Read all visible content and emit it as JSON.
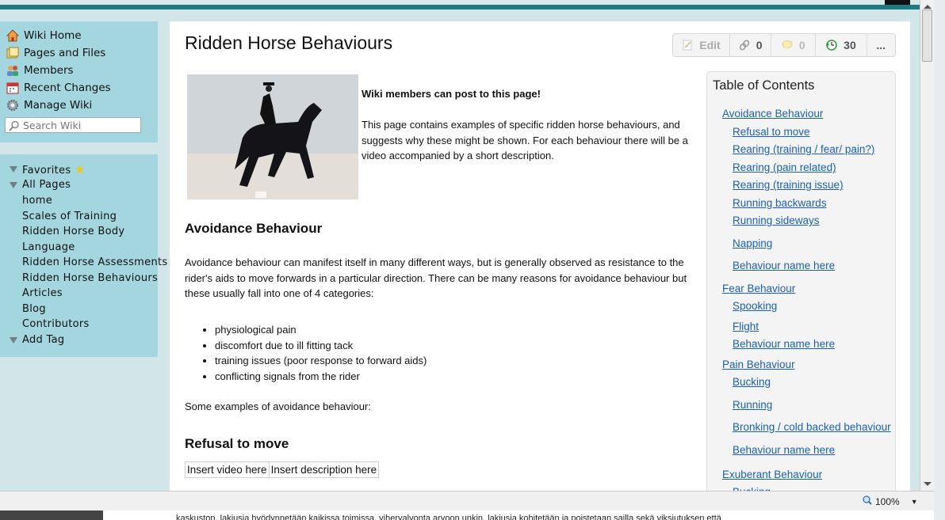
{
  "sidebar": {
    "top_items": [
      {
        "label": "Wiki Home",
        "icon": "house-icon"
      },
      {
        "label": "Pages and Files",
        "icon": "folder-icon"
      },
      {
        "label": "Members",
        "icon": "members-icon"
      },
      {
        "label": "Recent Changes",
        "icon": "calendar-icon"
      },
      {
        "label": "Manage Wiki",
        "icon": "gear-icon"
      }
    ],
    "search_placeholder": "Search Wiki",
    "favorites_label": "Favorites",
    "all_pages_label": "All Pages",
    "pages": [
      "home",
      "Scales of Training",
      "Ridden Horse Body",
      "Language",
      "Ridden Horse Assessments",
      "Ridden Horse Behaviours",
      "Articles",
      "Blog",
      "Contributors"
    ],
    "add_tag_label": "Add Tag"
  },
  "page": {
    "title": "Ridden Horse Behaviours",
    "toolbar": {
      "edit_label": "Edit",
      "links_count": "0",
      "comments_count": "0",
      "revisions_count": "30",
      "more_label": "..."
    },
    "intro_bold": "Wiki members can post to this page!",
    "intro_text": "This page contains examples of specific ridden horse behaviours, and suggests why these might be shown. For each behaviour there will be a video accompanied by a short description.",
    "section1_heading": "Avoidance Behaviour",
    "section1_text": "Avoidance behaviour can manifest itself in many different ways, but is generally observed as resistance to the rider's aids to move forwards in a particular direction. There can be many reasons for avoidance behaviour but these usually fall into one of 4 categories:",
    "bullets": [
      "physiological pain",
      "discomfort due to ill fitting tack",
      "training issues (poor response to forward aids)",
      "conflicting signals from the rider"
    ],
    "examples_text": "Some examples of avoidance behaviour:",
    "subsection_heading": "Refusal to move",
    "table": {
      "video": "Insert video here",
      "description": "Insert description here"
    }
  },
  "toc": {
    "title": "Table of Contents",
    "items": [
      {
        "label": "Avoidance Behaviour",
        "level": 1
      },
      {
        "label": "Refusal to move",
        "level": 2
      },
      {
        "label": "Rearing (training / fear/ pain?)",
        "level": 2
      },
      {
        "label": "Rearing (pain related)",
        "level": 2
      },
      {
        "label": "Rearing (training issue)",
        "level": 2
      },
      {
        "label": "Running backwards",
        "level": 2
      },
      {
        "label": "Running sideways",
        "level": 2
      },
      {
        "label": "Napping",
        "level": 2
      },
      {
        "label": "Behaviour name here",
        "level": 2
      },
      {
        "label": "Fear Behaviour",
        "level": 1
      },
      {
        "label": "Spooking",
        "level": 2
      },
      {
        "label": "Flight",
        "level": 2
      },
      {
        "label": "Behaviour name here",
        "level": 2
      },
      {
        "label": "Pain Behaviour",
        "level": 1
      },
      {
        "label": "Bucking",
        "level": 2
      },
      {
        "label": "Running",
        "level": 2
      },
      {
        "label": "Bronking / cold backed behaviour",
        "level": 2
      },
      {
        "label": "Behaviour name here",
        "level": 2
      },
      {
        "label": "Exuberant Behaviour",
        "level": 1
      },
      {
        "label": "Bucking",
        "level": 2
      }
    ]
  },
  "statusbar": {
    "zoom": "100%"
  },
  "below_text": "kaskuston, lakiusia hyödynnetään kaikissa toimissa, viheryalvonta arvoon unkin, lakiusia kohitetään ja poistetaan sailla sekä viksiutuksen että"
}
